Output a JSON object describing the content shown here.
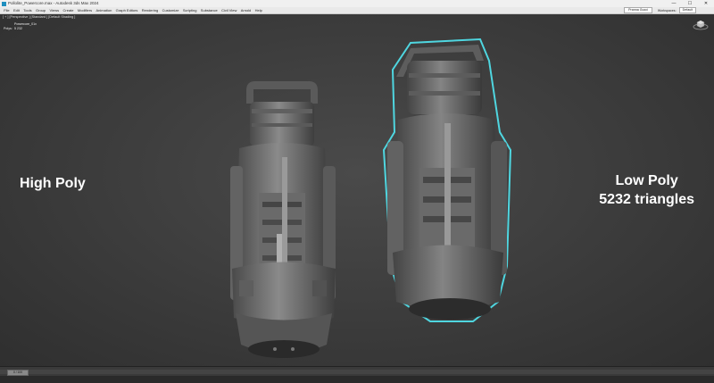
{
  "window": {
    "title": "Pollolite_Powercore.max - Autodesk 3ds Max 2024",
    "controls": [
      "—",
      "☐",
      "✕"
    ]
  },
  "menu": {
    "items": [
      "File",
      "Edit",
      "Tools",
      "Group",
      "Views",
      "Create",
      "Modifiers",
      "Animation",
      "Graph Editors",
      "Rendering",
      "Customize",
      "Scripting",
      "Substance",
      "Civil View",
      "Arnold",
      "Help"
    ],
    "sign_in": "Pranna Gucci",
    "workspaces_label": "Workspaces:",
    "workspaces_value": "Default"
  },
  "viewport": {
    "label": "[ + ] [Perspective ] [Standard ] [Default Shading ]",
    "stats": {
      "object": "Powercore_01x",
      "polys_label": "Polys:",
      "polys_value": "5 232"
    },
    "annotations": {
      "high_poly": "High Poly",
      "low_poly": "Low Poly",
      "triangles": "5232 triangles"
    }
  },
  "timeline": {
    "frame": "0 / 100"
  },
  "colors": {
    "selection_outline": "#4fd6e0",
    "model_gray": "#7c7c7c",
    "viewport_bg": "#3e3e3e"
  }
}
